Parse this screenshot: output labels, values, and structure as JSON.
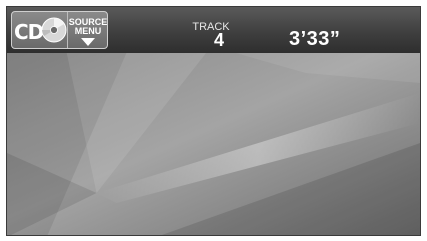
{
  "source_button": {
    "label": "CD",
    "menu_line1": "SOURCE",
    "menu_line2": "MENU",
    "disc_icon": "cd-disc-icon",
    "menu_icon": "triangle-down-icon"
  },
  "track": {
    "label": "TRACK",
    "number": "4"
  },
  "elapsed_time": "3’33”",
  "colors": {
    "topbar": "#3f3f3f",
    "background": "#9a9a9a",
    "text": "#ffffff"
  }
}
